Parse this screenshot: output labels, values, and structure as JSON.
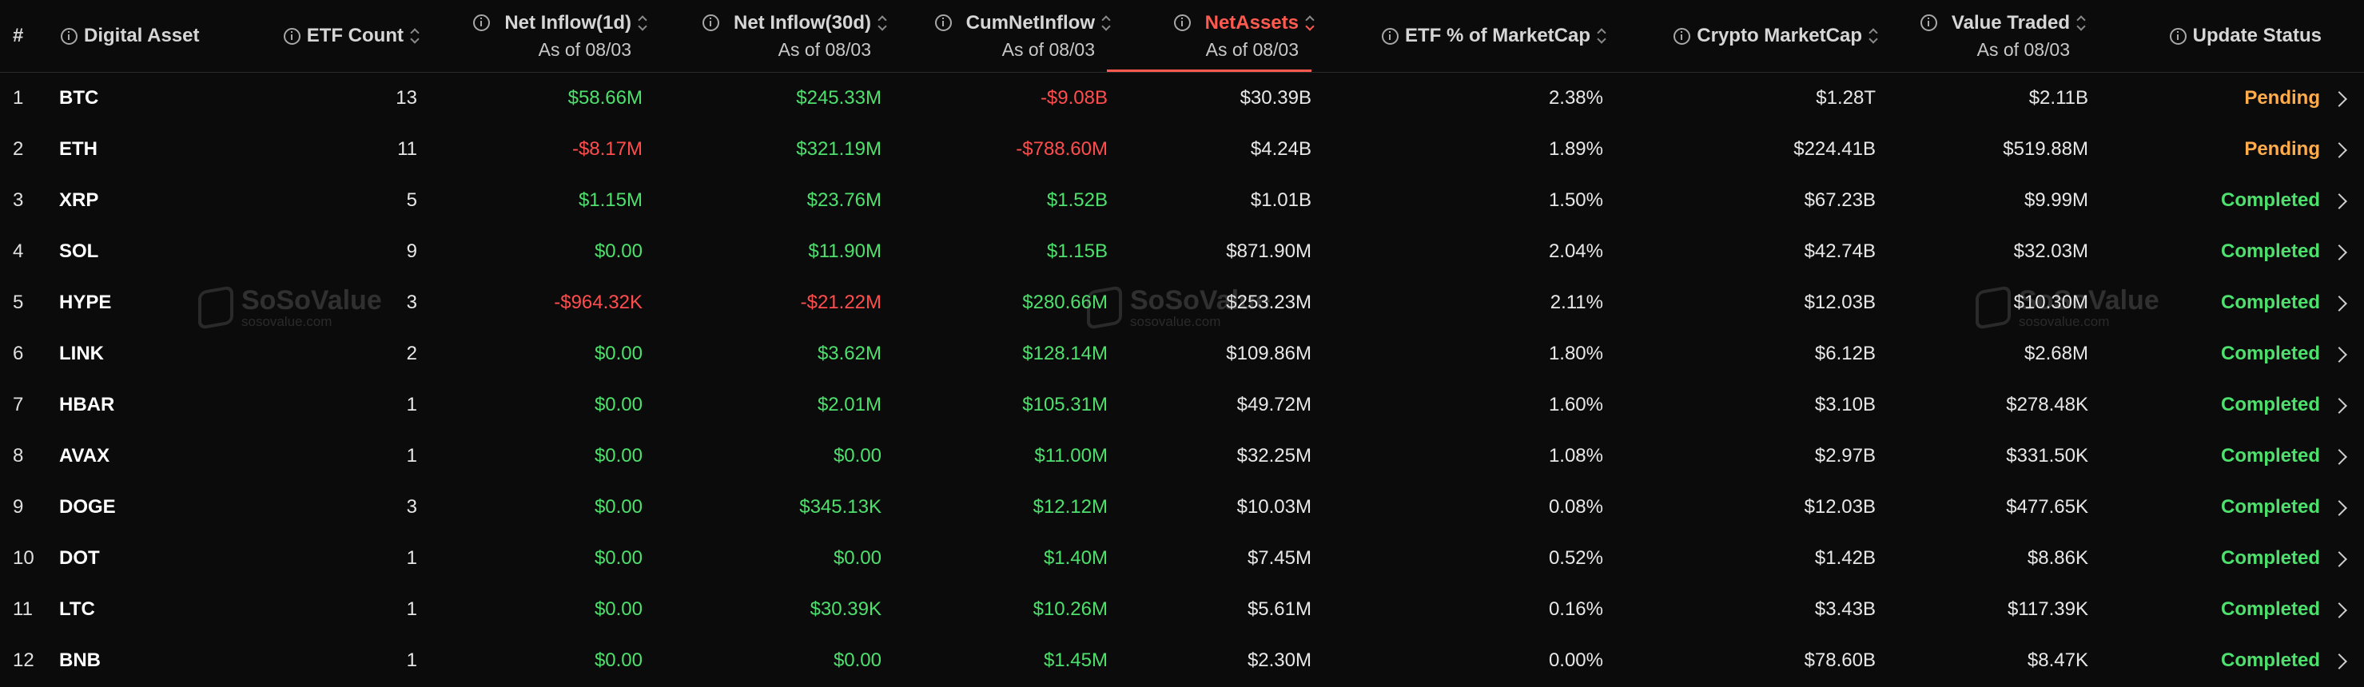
{
  "header": {
    "col_index": "#",
    "col_asset": "Digital Asset",
    "col_etf_count": "ETF Count",
    "col_inflow_1d": "Net Inflow(1d)",
    "col_inflow_1d_sub": "As of 08/03",
    "col_inflow_30d": "Net Inflow(30d)",
    "col_inflow_30d_sub": "As of 08/03",
    "col_cum_inflow": "CumNetInflow",
    "col_cum_inflow_sub": "As of 08/03",
    "col_net_assets": "NetAssets",
    "col_net_assets_sub": "As of 08/03",
    "col_etf_pct": "ETF % of MarketCap",
    "col_mcap": "Crypto MarketCap",
    "col_value_traded": "Value Traded",
    "col_value_traded_sub": "As of 08/03",
    "col_status": "Update Status"
  },
  "watermark": {
    "name": "SoSoValue",
    "url": "sosovalue.com"
  },
  "colors": {
    "positive": "#4ee06d",
    "negative": "#ff4d4d",
    "pending": "#ffac4d",
    "active_sort": "#ff5a4f"
  },
  "rows": [
    {
      "index": "1",
      "asset": "BTC",
      "etf_count": "13",
      "inflow_1d": "$58.66M",
      "inflow_30d": "$245.33M",
      "cum_inflow": "-$9.08B",
      "net_assets": "$30.39B",
      "etf_pct": "2.38%",
      "mcap": "$1.28T",
      "value_traded": "$2.11B",
      "status": "Pending"
    },
    {
      "index": "2",
      "asset": "ETH",
      "etf_count": "11",
      "inflow_1d": "-$8.17M",
      "inflow_30d": "$321.19M",
      "cum_inflow": "-$788.60M",
      "net_assets": "$4.24B",
      "etf_pct": "1.89%",
      "mcap": "$224.41B",
      "value_traded": "$519.88M",
      "status": "Pending"
    },
    {
      "index": "3",
      "asset": "XRP",
      "etf_count": "5",
      "inflow_1d": "$1.15M",
      "inflow_30d": "$23.76M",
      "cum_inflow": "$1.52B",
      "net_assets": "$1.01B",
      "etf_pct": "1.50%",
      "mcap": "$67.23B",
      "value_traded": "$9.99M",
      "status": "Completed"
    },
    {
      "index": "4",
      "asset": "SOL",
      "etf_count": "9",
      "inflow_1d": "$0.00",
      "inflow_30d": "$11.90M",
      "cum_inflow": "$1.15B",
      "net_assets": "$871.90M",
      "etf_pct": "2.04%",
      "mcap": "$42.74B",
      "value_traded": "$32.03M",
      "status": "Completed"
    },
    {
      "index": "5",
      "asset": "HYPE",
      "etf_count": "3",
      "inflow_1d": "-$964.32K",
      "inflow_30d": "-$21.22M",
      "cum_inflow": "$280.66M",
      "net_assets": "$253.23M",
      "etf_pct": "2.11%",
      "mcap": "$12.03B",
      "value_traded": "$10.30M",
      "status": "Completed"
    },
    {
      "index": "6",
      "asset": "LINK",
      "etf_count": "2",
      "inflow_1d": "$0.00",
      "inflow_30d": "$3.62M",
      "cum_inflow": "$128.14M",
      "net_assets": "$109.86M",
      "etf_pct": "1.80%",
      "mcap": "$6.12B",
      "value_traded": "$2.68M",
      "status": "Completed"
    },
    {
      "index": "7",
      "asset": "HBAR",
      "etf_count": "1",
      "inflow_1d": "$0.00",
      "inflow_30d": "$2.01M",
      "cum_inflow": "$105.31M",
      "net_assets": "$49.72M",
      "etf_pct": "1.60%",
      "mcap": "$3.10B",
      "value_traded": "$278.48K",
      "status": "Completed"
    },
    {
      "index": "8",
      "asset": "AVAX",
      "etf_count": "1",
      "inflow_1d": "$0.00",
      "inflow_30d": "$0.00",
      "cum_inflow": "$11.00M",
      "net_assets": "$32.25M",
      "etf_pct": "1.08%",
      "mcap": "$2.97B",
      "value_traded": "$331.50K",
      "status": "Completed"
    },
    {
      "index": "9",
      "asset": "DOGE",
      "etf_count": "3",
      "inflow_1d": "$0.00",
      "inflow_30d": "$345.13K",
      "cum_inflow": "$12.12M",
      "net_assets": "$10.03M",
      "etf_pct": "0.08%",
      "mcap": "$12.03B",
      "value_traded": "$477.65K",
      "status": "Completed"
    },
    {
      "index": "10",
      "asset": "DOT",
      "etf_count": "1",
      "inflow_1d": "$0.00",
      "inflow_30d": "$0.00",
      "cum_inflow": "$1.40M",
      "net_assets": "$7.45M",
      "etf_pct": "0.52%",
      "mcap": "$1.42B",
      "value_traded": "$8.86K",
      "status": "Completed"
    },
    {
      "index": "11",
      "asset": "LTC",
      "etf_count": "1",
      "inflow_1d": "$0.00",
      "inflow_30d": "$30.39K",
      "cum_inflow": "$10.26M",
      "net_assets": "$5.61M",
      "etf_pct": "0.16%",
      "mcap": "$3.43B",
      "value_traded": "$117.39K",
      "status": "Completed"
    },
    {
      "index": "12",
      "asset": "BNB",
      "etf_count": "1",
      "inflow_1d": "$0.00",
      "inflow_30d": "$0.00",
      "cum_inflow": "$1.45M",
      "net_assets": "$2.30M",
      "etf_pct": "0.00%",
      "mcap": "$78.60B",
      "value_traded": "$8.47K",
      "status": "Completed"
    }
  ]
}
